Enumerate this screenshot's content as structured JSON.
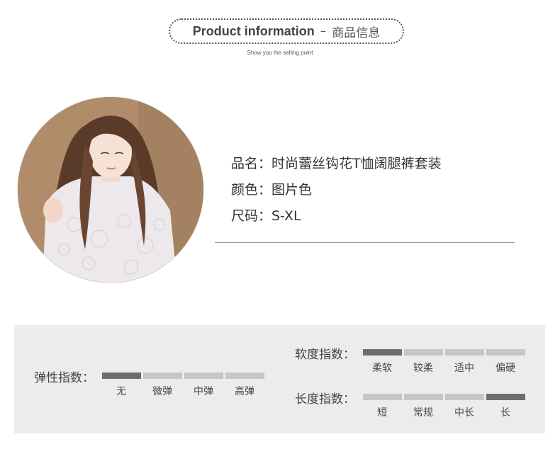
{
  "header": {
    "title_en": "Product information",
    "dash": "–",
    "title_cn": "商品信息",
    "subtitle": "Show you the selling point"
  },
  "product": {
    "name": "品名：时尚蕾丝钩花T恤阔腿裤套装",
    "color": "颜色：图片色",
    "size": "尺码：S-XL"
  },
  "indices": {
    "elasticity": {
      "label": "弹性指数：",
      "options": [
        "无",
        "微弹",
        "中弹",
        "高弹"
      ],
      "selected_index": 0
    },
    "softness": {
      "label": "软度指数：",
      "options": [
        "柔软",
        "较柔",
        "适中",
        "偏硬"
      ],
      "selected_index": 0
    },
    "length": {
      "label": "长度指数：",
      "options": [
        "短",
        "常规",
        "中长",
        "长"
      ],
      "selected_index": 3
    }
  },
  "colors": {
    "bar_active": "#6d6d6d",
    "bar_inactive": "#c6c6c6",
    "panel_bg": "#ececec"
  },
  "icons": {
    "photo": "model-photo"
  }
}
